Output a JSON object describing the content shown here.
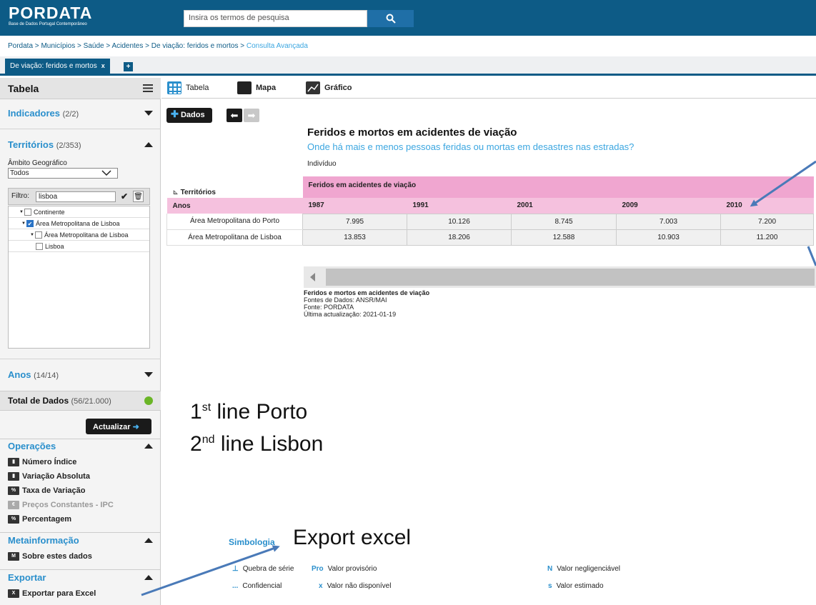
{
  "header": {
    "logo_text": "PORDATA",
    "logo_subtitle": "Base de Dados Portugal Contemporâneo",
    "search_placeholder": "Insira os termos de pesquisa"
  },
  "breadcrumb": {
    "items": [
      "Pordata",
      "Municípios",
      "Saúde",
      "Acidentes",
      "De viação: feridos e mortos"
    ],
    "last": "Consulta Avançada",
    "separator": " > "
  },
  "tab": {
    "label": "De viação: feridos e mortos",
    "close": "x",
    "add": "+"
  },
  "sidebar": {
    "title": "Tabela",
    "indicadores": {
      "label": "Indicadores",
      "count": "(2/2)"
    },
    "territorios": {
      "label": "Territórios",
      "count": "(2/353)"
    },
    "ambito_label": "Âmbito Geográfico",
    "ambito_value": "Todos",
    "filtro_label": "Filtro:",
    "filtro_value": "lisboa",
    "tree": [
      {
        "label": "Continente",
        "checked": false
      },
      {
        "label": "Área Metropolitana de Lisboa",
        "checked": true
      },
      {
        "label": "Área Metropolitana de Lisboa",
        "checked": false
      },
      {
        "label": "Lisboa",
        "checked": false
      }
    ],
    "anos": {
      "label": "Anos",
      "count": "(14/14)"
    },
    "total": {
      "label": "Total de Dados",
      "count": "(56/21.000)"
    },
    "actualizar": "Actualizar",
    "operacoes": {
      "title": "Operações",
      "items": [
        "Número Índice",
        "Variação Absoluta",
        "Taxa de Variação",
        "Preços Constantes - IPC",
        "Percentagem"
      ]
    },
    "metainformacao": {
      "title": "Metainformação",
      "item": "Sobre estes dados"
    },
    "exportar": {
      "title": "Exportar",
      "item": "Exportar para Excel"
    }
  },
  "toolbar": {
    "tabela": "Tabela",
    "mapa": "Mapa",
    "grafico": "Gráfico"
  },
  "dados_button": "Dados",
  "content": {
    "title": "Feridos e mortos em acidentes de viação",
    "subtitle": "Onde há mais e menos pessoas feridas ou mortas em desastres nas estradas?",
    "unit": "Indivíduo",
    "territorios_label": "Territórios",
    "anos_label": "Anos",
    "group_header": "Feridos em acidentes de viação",
    "years": [
      "1987",
      "1991",
      "2001",
      "2009",
      "2010"
    ],
    "rows": [
      {
        "name": "Área Metropolitana do Porto",
        "values": [
          "7.995",
          "10.126",
          "8.745",
          "7.003",
          "7.200"
        ]
      },
      {
        "name": "Área Metropolitana de Lisboa",
        "values": [
          "13.853",
          "18.206",
          "12.588",
          "10.903",
          "11.200"
        ]
      }
    ],
    "source_title": "Feridos e mortos em acidentes de viação",
    "source_lines": [
      "Fontes de Dados: ANSR/MAI",
      "Fonte: PORDATA",
      "Última actualização: 2021-01-19"
    ]
  },
  "annotations": {
    "line1_num": "1",
    "line1_sup": "st",
    "line1_text": " line Porto",
    "line2_num": "2",
    "line2_sup": "nd",
    "line2_text": " line Lisbon",
    "export": "Export excel"
  },
  "simbologia": {
    "title": "Simbologia",
    "items": [
      {
        "key": "⊥",
        "label": "Quebra de série"
      },
      {
        "key": "Pro",
        "label": "Valor provisório"
      },
      {
        "key": "N",
        "label": "Valor negligenciável"
      },
      {
        "key": "...",
        "label": "Confidencial"
      },
      {
        "key": "x",
        "label": "Valor não disponível"
      },
      {
        "key": "s",
        "label": "Valor estimado"
      }
    ]
  },
  "colors": {
    "brand": "#0d5b86",
    "accent": "#2a8fcc",
    "pink": "#f0a6d0"
  }
}
